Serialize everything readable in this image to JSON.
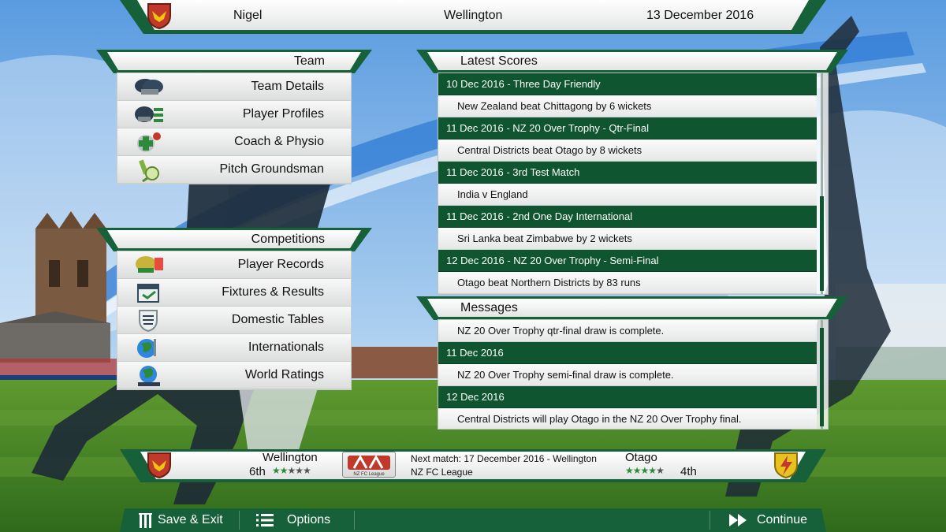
{
  "header": {
    "manager": "Nigel",
    "team": "Wellington",
    "date": "13 December 2016"
  },
  "team_menu": {
    "title": "Team",
    "items": [
      {
        "label": "Team Details",
        "icon": "helmets-icon"
      },
      {
        "label": "Player Profiles",
        "icon": "player-list-icon"
      },
      {
        "label": "Coach & Physio",
        "icon": "medical-cross-icon"
      },
      {
        "label": "Pitch Groundsman",
        "icon": "pitch-magnifier-icon"
      }
    ]
  },
  "competitions_menu": {
    "title": "Competitions",
    "items": [
      {
        "label": "Player Records",
        "icon": "records-icon"
      },
      {
        "label": "Fixtures & Results",
        "icon": "calendar-icon"
      },
      {
        "label": "Domestic Tables",
        "icon": "shield-table-icon"
      },
      {
        "label": "Internationals",
        "icon": "globe-flag-icon"
      },
      {
        "label": "World Ratings",
        "icon": "globe-stars-icon"
      }
    ]
  },
  "latest_scores": {
    "title": "Latest Scores",
    "entries": [
      {
        "heading": "10 Dec 2016 - Three Day Friendly",
        "result": "New Zealand beat Chittagong by 6 wickets"
      },
      {
        "heading": "11 Dec 2016 - NZ 20 Over Trophy - Qtr-Final",
        "result": "Central Districts beat Otago by 8 wickets"
      },
      {
        "heading": "11 Dec 2016 - 3rd Test Match",
        "result": "India v England"
      },
      {
        "heading": "11 Dec 2016 - 2nd One Day International",
        "result": "Sri Lanka beat Zimbabwe by 2 wickets"
      },
      {
        "heading": "12 Dec 2016 - NZ 20 Over Trophy - Semi-Final",
        "result": "Otago beat Northern Districts by 83 runs"
      }
    ]
  },
  "messages": {
    "title": "Messages",
    "first_body": "NZ 20 Over Trophy qtr-final draw is complete.",
    "entries": [
      {
        "heading": "11 Dec 2016",
        "body": "NZ 20 Over Trophy semi-final draw is complete."
      },
      {
        "heading": "12 Dec 2016",
        "body": "Central Districts will play Otago in the NZ 20 Over Trophy final."
      }
    ]
  },
  "match_bar": {
    "home_team": "Wellington",
    "home_position": "6th",
    "home_rating": 2,
    "away_team": "Otago",
    "away_position": "4th",
    "away_rating": 4,
    "rating_max": 5,
    "next_match": "Next match:  17 December 2016 - Wellington",
    "league": "NZ FC League",
    "league_logo_text": "NZ FC League"
  },
  "bottom_bar": {
    "save_exit": "Save & Exit",
    "options": "Options",
    "continue": "Continue"
  },
  "colors": {
    "accent_green": "#0f5630",
    "home_crest": "#c0392b",
    "away_crest": "#e8c21f"
  }
}
